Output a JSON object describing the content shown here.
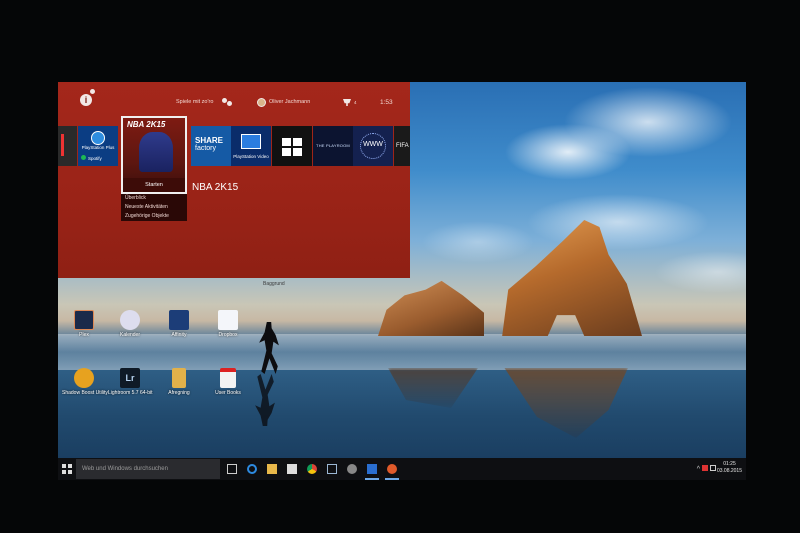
{
  "ps4": {
    "notification_badge": "1",
    "status": "Spiele mit zo'ro",
    "user": "Oliver Jachmann",
    "trophies": "4",
    "time": "1:53",
    "tiles": {
      "psplus_label": "PlayStation Plus",
      "spotify_label": "Spotify",
      "cover_title": "NBA 2K15",
      "share_line1": "SHARE",
      "share_line2": "factory",
      "psvideo_label": "PlayStation Video",
      "playroom_label": "THE PLAYROOM",
      "www_label": "WWW",
      "fifa_label": "FIFA"
    },
    "selected_game_name": "NBA 2K15",
    "start_button": "Starten",
    "menu": [
      "Überblick",
      "Neueste Aktivitäten",
      "Zugehörige Objekte"
    ]
  },
  "desktop": {
    "baggrund_label": "Baggrund",
    "icons": [
      {
        "label": "Plex"
      },
      {
        "label": "Kalender"
      },
      {
        "label": "Affinity"
      },
      {
        "label": "Dropbox"
      },
      {
        "label": "Shadow Boost Utility"
      },
      {
        "label": "Lightroom 5.7 64-bit"
      },
      {
        "label": "Afregning"
      },
      {
        "label": "User Books"
      }
    ]
  },
  "taskbar": {
    "search_placeholder": "Web und Windows durchsuchen",
    "apps": [
      "task-view",
      "edge",
      "explorer",
      "store",
      "chrome",
      "lightroom",
      "media-player",
      "remote-play",
      "app"
    ],
    "tray": "^",
    "clock_time": "01:25",
    "clock_date": "03.08.2015"
  }
}
